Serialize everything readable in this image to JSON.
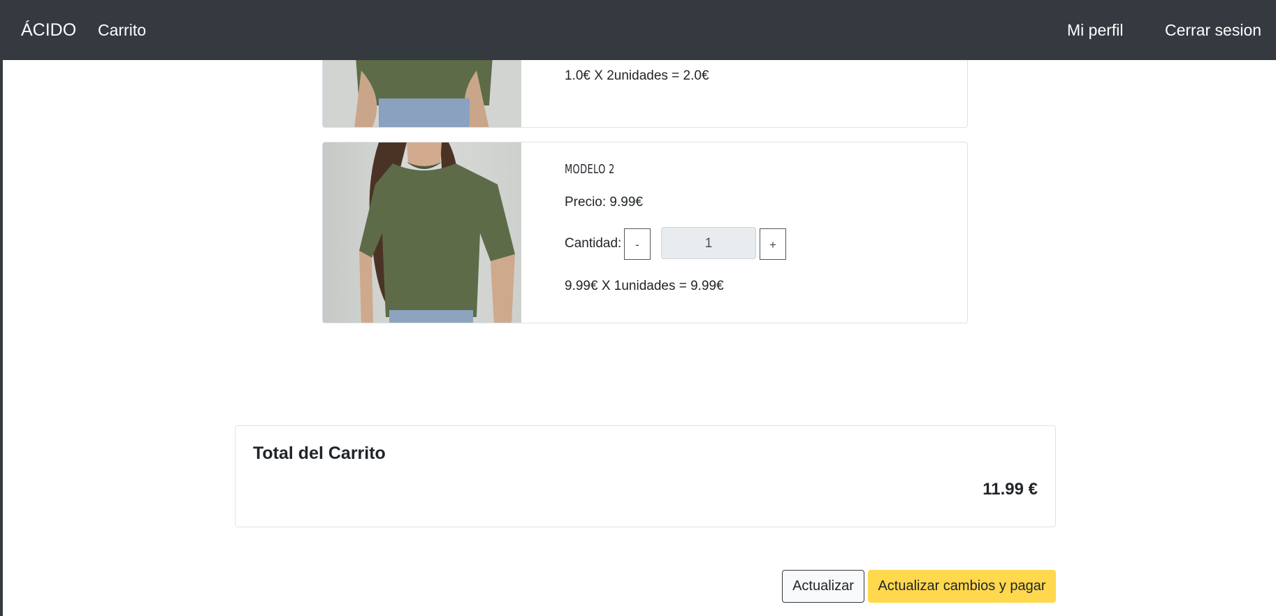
{
  "navbar": {
    "brand": "ÁCIDO",
    "cart": "Carrito",
    "profile": "Mi perfil",
    "logout": "Cerrar sesion"
  },
  "products": [
    {
      "subtotal": "1.0€ X 2unidades = 2.0€"
    },
    {
      "name": "MODELO 2",
      "price": "Precio: 9.99€",
      "qty_label": "Cantidad:",
      "qty_value": "1",
      "minus": "-",
      "plus": "+",
      "subtotal": "9.99€ X 1unidades = 9.99€"
    }
  ],
  "total": {
    "title": "Total del Carrito",
    "value": "11.99 €"
  },
  "actions": {
    "update": "Actualizar",
    "update_pay": "Actualizar cambios y pagar"
  },
  "colors": {
    "navbar_bg": "#343a40",
    "pay_button": "#ffd84d",
    "shirt": "#5d6b48"
  }
}
